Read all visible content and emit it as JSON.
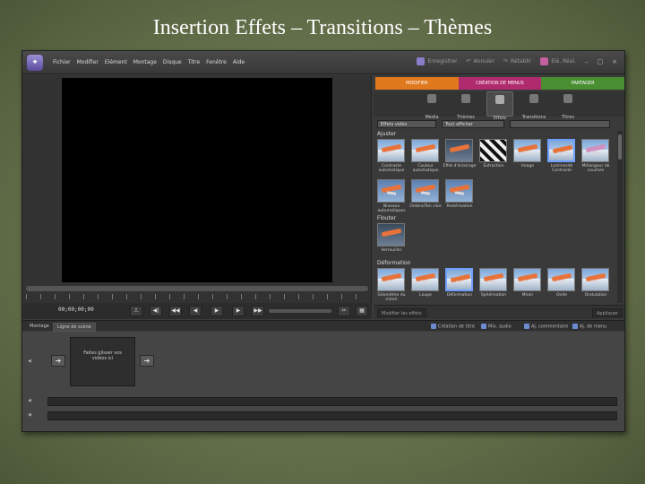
{
  "slide": {
    "title": "Insertion Effets – Transitions – Thèmes"
  },
  "app": {
    "menu": [
      "Fichier",
      "Modifier",
      "Elément",
      "Montage",
      "Disque",
      "Titre",
      "Fenêtre",
      "Aide"
    ],
    "top_actions": {
      "save": "Enregistrer",
      "undo": "Annuler",
      "redo": "Rétablir",
      "organizer": "Elé. Réal."
    }
  },
  "monitor": {
    "timecode": "00;00;00;00"
  },
  "panel": {
    "modes": [
      {
        "label": "MODIFIER",
        "color": "#e0791e"
      },
      {
        "label": "CRÉATION DE MENUS",
        "color": "#b02a6e"
      },
      {
        "label": "PARTAGER",
        "color": "#4a8e32"
      }
    ],
    "subtabs": [
      "Média",
      "Thèmes",
      "Effets",
      "Transitions",
      "Titres"
    ],
    "active_subtab": "Effets",
    "filter_category": "Effets vidéo",
    "filter_display": "Tout afficher",
    "search_placeholder": "",
    "categories": [
      {
        "name": "Ajuster",
        "items": [
          "Contraste automatique",
          "Couleur automatique",
          "Effet d'éclairage",
          "Extraction",
          "Image",
          "Luminosité Contraste",
          "Mélangeur de couches",
          "Niveaux automatiques",
          "Ombre/Ton clair",
          "Postérisation"
        ]
      },
      {
        "name": "Flouter",
        "items": [
          "Verrouiller"
        ]
      },
      {
        "name": "Déformation",
        "items": [
          "Géométrie du miroir",
          "Loupe",
          "Déformation",
          "Sphérisation",
          "Miroir",
          "Onde",
          "Ondulation"
        ]
      }
    ],
    "footer": {
      "show_effects": "Modifier les effets",
      "apply": "Appliquer"
    }
  },
  "timeline": {
    "tabs": [
      "Montage",
      "Ligne de scène"
    ],
    "actions": [
      "Création de titre",
      "Mix. audio",
      "Aj. commentaire",
      "Aj. de menu"
    ],
    "drop_text": "Faites glisser vos vidéos ici"
  }
}
